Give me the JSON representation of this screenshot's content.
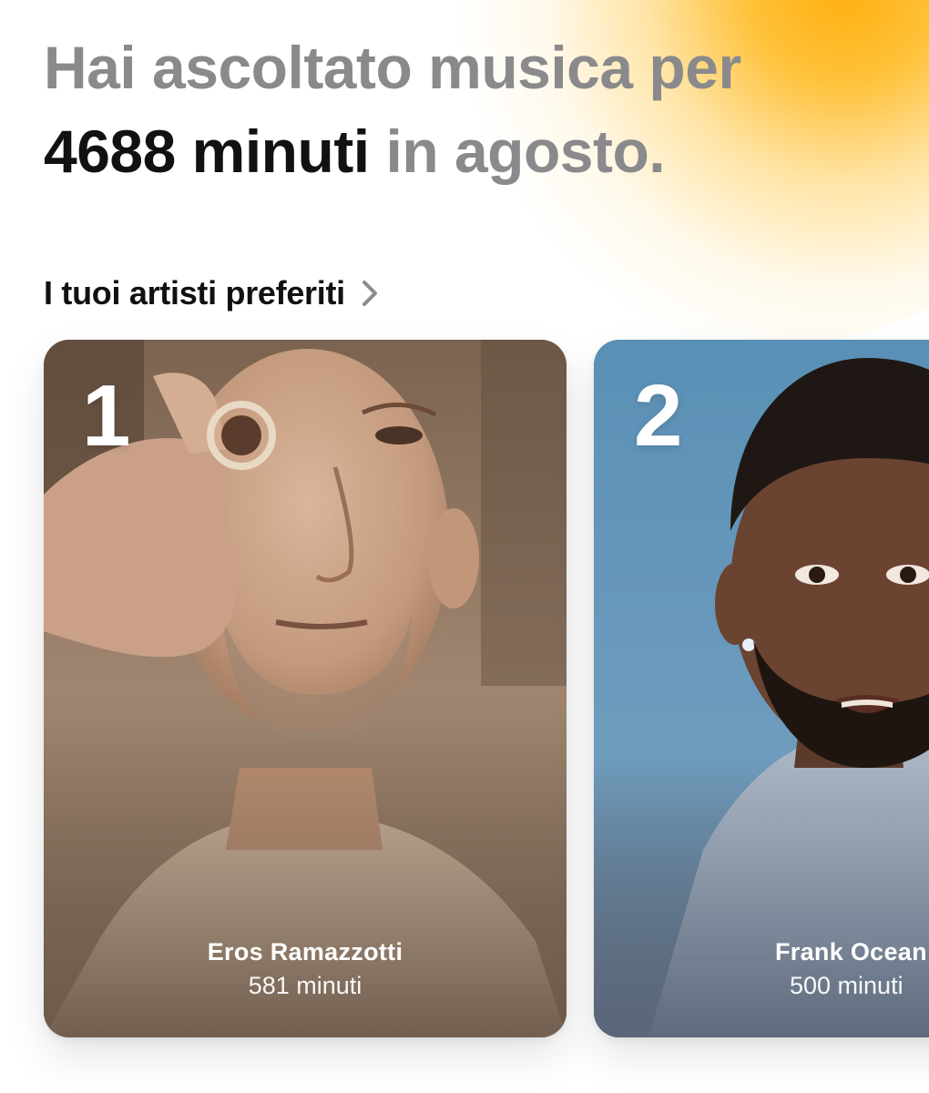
{
  "headline": {
    "line1": "Hai ascoltato musica per",
    "minutes_value": "4688 minuti",
    "line2_suffix": " in agosto."
  },
  "section": {
    "title": "I tuoi artisti preferiti"
  },
  "artists": [
    {
      "rank": "1",
      "name": "Eros Ramazzotti",
      "minutes": "581 minuti"
    },
    {
      "rank": "2",
      "name": "Frank Ocean",
      "minutes": "500 minuti"
    }
  ],
  "colors": {
    "accent_glow": "#FFB000",
    "headline_gray": "#8a8a8c",
    "text_dark": "#111111"
  },
  "icons": {
    "section_chevron": "chevron-right-icon"
  }
}
